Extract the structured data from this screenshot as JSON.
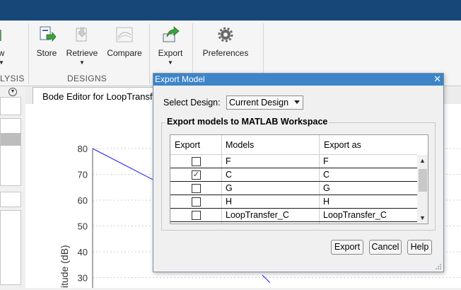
{
  "toolstrip": {
    "partial_labels": [
      "w"
    ],
    "sections": [
      "LYSIS",
      "DESIGNS"
    ],
    "buttons": {
      "store": "Store",
      "retrieve": "Retrieve",
      "compare": "Compare",
      "export": "Export",
      "preferences": "Preferences"
    }
  },
  "document": {
    "tab_label": "Bode Editor for LoopTransf"
  },
  "plot": {
    "ylabel": "itude (dB)",
    "line_color": "#1a1aff"
  },
  "chart_data": {
    "type": "line",
    "ylabel": "itude (dB)",
    "yticks": [
      80,
      70,
      60,
      50,
      40,
      30
    ],
    "ylim": [
      28,
      80
    ],
    "series": [
      {
        "values": [
          80,
          68
        ]
      },
      {
        "values": [
          31,
          28
        ]
      }
    ]
  },
  "dialog": {
    "title": "Export Model",
    "select_label": "Select Design:",
    "select_value": "Current Design",
    "group_title": "Export models to MATLAB Workspace",
    "columns": [
      "Export",
      "Models",
      "Export as"
    ],
    "rows": [
      {
        "checked": false,
        "model": "F",
        "export_as": "F"
      },
      {
        "checked": true,
        "model": "C",
        "export_as": "C"
      },
      {
        "checked": false,
        "model": "G",
        "export_as": "G"
      },
      {
        "checked": false,
        "model": "H",
        "export_as": "H"
      },
      {
        "checked": false,
        "model": "LoopTransfer_C",
        "export_as": "LoopTransfer_C"
      }
    ],
    "buttons": {
      "export": "Export",
      "cancel": "Cancel",
      "help": "Help"
    }
  },
  "colors": {
    "titlebar": "#174778",
    "dialog_title": "#3d85c8"
  }
}
